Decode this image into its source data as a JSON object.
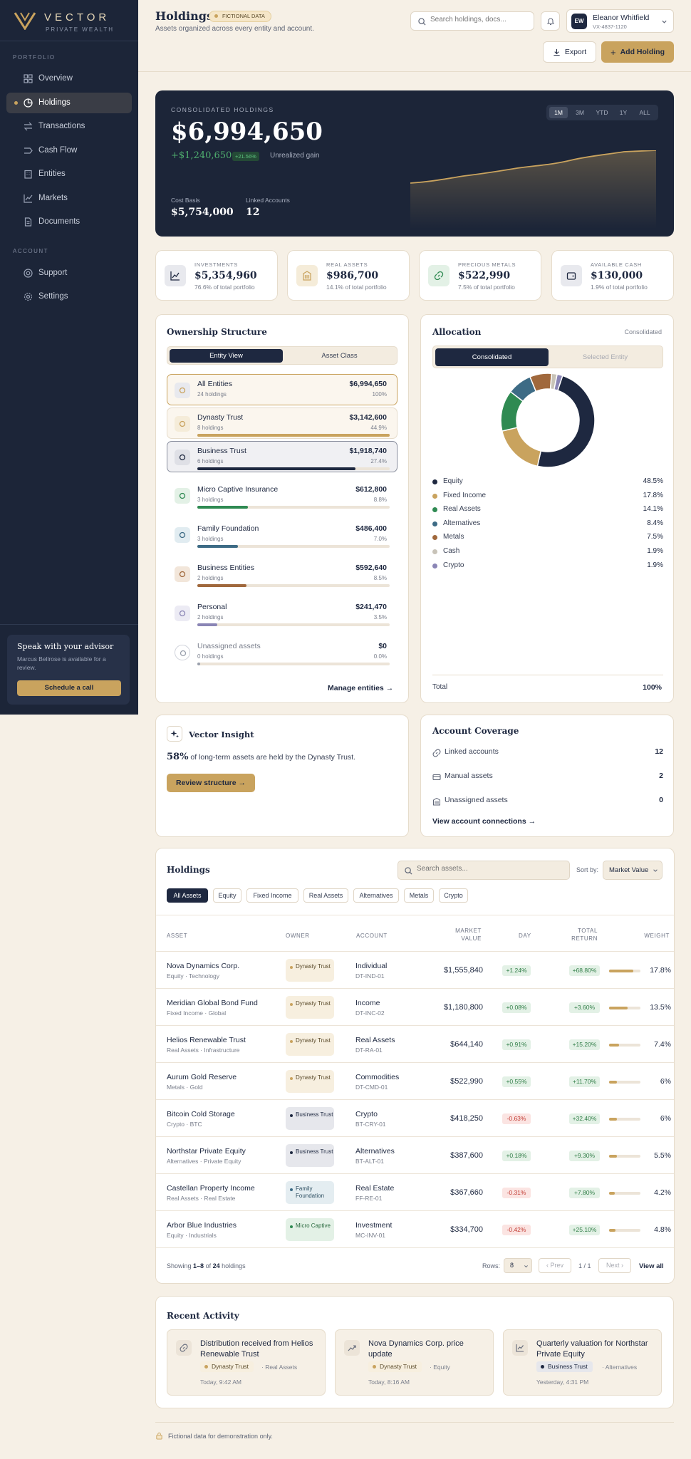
{
  "brand": {
    "name": "VECTOR",
    "sub": "PRIVATE WEALTH"
  },
  "sidebar": {
    "portfolio_label": "PORTFOLIO",
    "account_label": "ACCOUNT",
    "items": [
      {
        "label": "Overview",
        "icon": "grid-icon"
      },
      {
        "label": "Holdings",
        "icon": "pie-chart-icon",
        "active": true
      },
      {
        "label": "Transactions",
        "icon": "arrows-swap-icon"
      },
      {
        "label": "Cash Flow",
        "icon": "flow-icon"
      },
      {
        "label": "Entities",
        "icon": "building-icon"
      },
      {
        "label": "Markets",
        "icon": "chart-line-icon"
      },
      {
        "label": "Documents",
        "icon": "document-icon"
      }
    ],
    "account_items": [
      {
        "label": "Support",
        "icon": "lifebuoy-icon"
      },
      {
        "label": "Settings",
        "icon": "gear-icon"
      }
    ],
    "advisor": {
      "title": "Speak with your advisor",
      "text": "Marcus Bellrose is available for a review.",
      "button": "Schedule a call"
    }
  },
  "header": {
    "title": "Holdings",
    "badge": "FICTIONAL DATA",
    "subtitle": "Assets organized across every entity and account.",
    "search_placeholder": "Search holdings, docs...",
    "user": {
      "initials": "EW",
      "name": "Eleanor Whitfield",
      "id": "VX-4837-1120"
    },
    "export_label": "Export",
    "add_label": "Add Holding"
  },
  "hero": {
    "label": "CONSOLIDATED HOLDINGS",
    "value": "$6,994,650",
    "gain": "+$1,240,650",
    "gain_pct": "+21.56%",
    "gain_label": "Unrealized gain",
    "cost_basis_label": "Cost Basis",
    "cost_basis": "$5,754,000",
    "linked_label": "Linked Accounts",
    "linked": "12",
    "ranges": [
      "1M",
      "3M",
      "YTD",
      "1Y",
      "ALL"
    ],
    "active_range": "1M"
  },
  "kpis": [
    {
      "label": "INVESTMENTS",
      "value": "$5,354,960",
      "sub": "76.6% of total portfolio",
      "icon": "chart-line-icon",
      "color": "#e8e9ee"
    },
    {
      "label": "REAL ASSETS",
      "value": "$986,700",
      "sub": "14.1% of total portfolio",
      "icon": "building-icon",
      "color": "#f5ecd9"
    },
    {
      "label": "PRECIOUS METALS",
      "value": "$522,990",
      "sub": "7.5% of total portfolio",
      "icon": "link-icon",
      "color": "#e3f1e6"
    },
    {
      "label": "AVAILABLE CASH",
      "value": "$130,000",
      "sub": "1.9% of total portfolio",
      "icon": "wallet-icon",
      "color": "#e8e9ee"
    }
  ],
  "ownership": {
    "title": "Ownership Structure",
    "tabs": [
      "Entity View",
      "Asset Class"
    ],
    "entities": [
      {
        "name": "All Entities",
        "holdings": "24 holdings",
        "value": "$6,994,650",
        "pct": "100%",
        "share": 100,
        "color": "#c9a35e",
        "icon": "layers-icon"
      },
      {
        "name": "Dynasty Trust",
        "holdings": "8 holdings",
        "value": "$3,142,600",
        "pct": "44.9%",
        "share": 44.9,
        "color": "#c9a35e",
        "icon": "shield-icon"
      },
      {
        "name": "Business Trust",
        "holdings": "6 holdings",
        "value": "$1,918,740",
        "pct": "27.4%",
        "share": 27.4,
        "color": "#1e2840",
        "icon": "bank-icon"
      },
      {
        "name": "Micro Captive Insurance",
        "holdings": "3 holdings",
        "value": "$612,800",
        "pct": "8.8%",
        "share": 8.8,
        "color": "#2f8a52",
        "icon": "umbrella-icon"
      },
      {
        "name": "Family Foundation",
        "holdings": "3 holdings",
        "value": "$486,400",
        "pct": "7.0%",
        "share": 7.0,
        "color": "#3d6b85",
        "icon": "heart-icon"
      },
      {
        "name": "Business Entities",
        "holdings": "2 holdings",
        "value": "$592,640",
        "pct": "8.5%",
        "share": 8.5,
        "color": "#a0683c",
        "icon": "briefcase-icon"
      },
      {
        "name": "Personal",
        "holdings": "2 holdings",
        "value": "$241,470",
        "pct": "3.5%",
        "share": 3.5,
        "color": "#8a85b5",
        "icon": "person-icon"
      },
      {
        "name": "Unassigned assets",
        "holdings": "0 holdings",
        "value": "$0",
        "pct": "0.0%",
        "share": 0,
        "color": "#9aa0ad",
        "icon": "circle-icon"
      }
    ],
    "manage_label": "Manage entities"
  },
  "allocation": {
    "title": "Allocation",
    "scope": "Consolidated",
    "tabs": [
      "Consolidated",
      "Selected Entity"
    ],
    "total_label": "Total",
    "total": "100%"
  },
  "chart_data": {
    "type": "pie",
    "categories": [
      "Equity",
      "Fixed Income",
      "Real Assets",
      "Alternatives",
      "Metals",
      "Cash",
      "Crypto"
    ],
    "values": [
      48.5,
      17.8,
      14.1,
      8.4,
      7.5,
      1.9,
      1.9
    ],
    "labels": [
      "48.5%",
      "17.8%",
      "14.1%",
      "8.4%",
      "7.5%",
      "1.9%",
      "1.9%"
    ],
    "colors": [
      "#1e2840",
      "#c9a35e",
      "#2f8a52",
      "#3d6b85",
      "#a0683c",
      "#c8c3b8",
      "#8a85b5"
    ]
  },
  "insight": {
    "title": "Vector Insight",
    "highlight": "58%",
    "text": "of long-term assets are held by the Dynasty Trust.",
    "button": "Review structure"
  },
  "coverage": {
    "title": "Account Coverage",
    "rows": [
      {
        "label": "Linked accounts",
        "value": "12",
        "icon": "link-icon"
      },
      {
        "label": "Manual assets",
        "value": "2",
        "icon": "card-icon"
      },
      {
        "label": "Unassigned assets",
        "value": "0",
        "icon": "building-icon"
      }
    ],
    "link": "View account connections"
  },
  "holdings": {
    "title": "Holdings",
    "search_placeholder": "Search assets...",
    "sort_label": "Sort by:",
    "sort_value": "Market Value",
    "filters": [
      "All Assets",
      "Equity",
      "Fixed Income",
      "Real Assets",
      "Alternatives",
      "Metals",
      "Crypto"
    ],
    "columns": {
      "asset": "ASSET",
      "owner": "OWNER",
      "account": "ACCOUNT",
      "market": "MARKET VALUE",
      "day": "DAY",
      "total": "TOTAL RETURN",
      "weight": "WEIGHT"
    },
    "rows": [
      {
        "asset": "Nova Dynamics Corp.",
        "sub": "Equity · Technology",
        "owner": "Dynasty Trust",
        "owner_type": "dynasty",
        "account": "Individual",
        "account_id": "DT-IND-01",
        "value": "$1,555,840",
        "day": "+1.24%",
        "day_dir": "pos",
        "total": "+68.80%",
        "weight": "17.8%",
        "weight_num": 17.8
      },
      {
        "asset": "Meridian Global Bond Fund",
        "sub": "Fixed Income · Global",
        "owner": "Dynasty Trust",
        "owner_type": "dynasty",
        "account": "Income",
        "account_id": "DT-INC-02",
        "value": "$1,180,800",
        "day": "+0.08%",
        "day_dir": "pos",
        "total": "+3.60%",
        "weight": "13.5%",
        "weight_num": 13.5
      },
      {
        "asset": "Helios Renewable Trust",
        "sub": "Real Assets · Infrastructure",
        "owner": "Dynasty Trust",
        "owner_type": "dynasty",
        "account": "Real Assets",
        "account_id": "DT-RA-01",
        "value": "$644,140",
        "day": "+0.91%",
        "day_dir": "pos",
        "total": "+15.20%",
        "weight": "7.4%",
        "weight_num": 7.4
      },
      {
        "asset": "Aurum Gold Reserve",
        "sub": "Metals · Gold",
        "owner": "Dynasty Trust",
        "owner_type": "dynasty",
        "account": "Commodities",
        "account_id": "DT-CMD-01",
        "value": "$522,990",
        "day": "+0.55%",
        "day_dir": "pos",
        "total": "+11.70%",
        "weight": "6%",
        "weight_num": 6
      },
      {
        "asset": "Bitcoin Cold Storage",
        "sub": "Crypto · BTC",
        "owner": "Business Trust",
        "owner_type": "business",
        "account": "Crypto",
        "account_id": "BT-CRY-01",
        "value": "$418,250",
        "day": "-0.63%",
        "day_dir": "neg",
        "total": "+32.40%",
        "weight": "6%",
        "weight_num": 6
      },
      {
        "asset": "Northstar Private Equity",
        "sub": "Alternatives · Private Equity",
        "owner": "Business Trust",
        "owner_type": "business",
        "account": "Alternatives",
        "account_id": "BT-ALT-01",
        "value": "$387,600",
        "day": "+0.18%",
        "day_dir": "pos",
        "total": "+9.30%",
        "weight": "5.5%",
        "weight_num": 5.5
      },
      {
        "asset": "Castellan Property Income",
        "sub": "Real Assets · Real Estate",
        "owner": "Family Foundation",
        "owner_type": "family",
        "account": "Real Estate",
        "account_id": "FF-RE-01",
        "value": "$367,660",
        "day": "-0.31%",
        "day_dir": "neg",
        "total": "+7.80%",
        "weight": "4.2%",
        "weight_num": 4.2
      },
      {
        "asset": "Arbor Blue Industries",
        "sub": "Equity · Industrials",
        "owner": "Micro Captive",
        "owner_type": "micro",
        "account": "Investment",
        "account_id": "MC-INV-01",
        "value": "$334,700",
        "day": "-0.42%",
        "day_dir": "neg",
        "total": "+25.10%",
        "weight": "4.8%",
        "weight_num": 4.8
      }
    ],
    "footer": {
      "showing": "Showing",
      "range": "1–8",
      "of": "of",
      "count": "24",
      "noun": "holdings",
      "rows_label": "Rows:",
      "rows_value": "8",
      "prev": "Prev",
      "page": "1 / 1",
      "next": "Next",
      "view_all": "View all"
    }
  },
  "activity": {
    "title": "Recent Activity",
    "items": [
      {
        "title": "Distribution received from Helios Renewable Trust",
        "tag": "Dynasty Trust",
        "tag_type": "dynasty",
        "category": "· Real Assets",
        "time": "Today, 9:42 AM",
        "icon": "link-icon"
      },
      {
        "title": "Nova Dynamics Corp. price update",
        "tag": "Dynasty Trust",
        "tag_type": "dynasty",
        "category": "· Equity",
        "time": "Today, 8:16 AM",
        "icon": "trend-icon"
      },
      {
        "title": "Quarterly valuation for Northstar Private Equity",
        "tag": "Business Trust",
        "tag_type": "business",
        "category": "· Alternatives",
        "time": "Yesterday, 4:31 PM",
        "icon": "chart-line-icon"
      }
    ]
  },
  "footer_note": "Fictional data for demonstration only."
}
